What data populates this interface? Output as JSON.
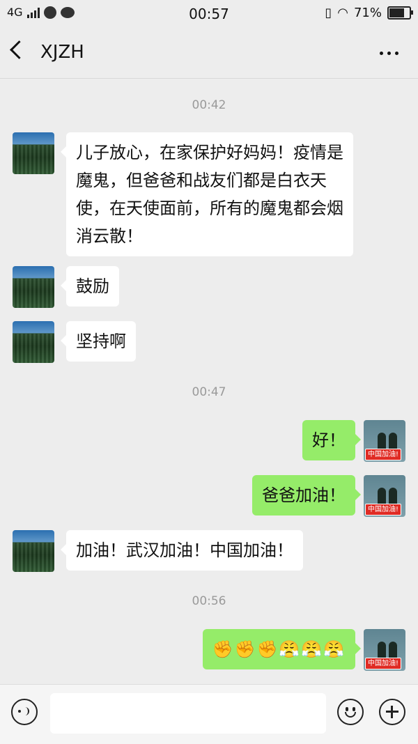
{
  "status_bar": {
    "network": "4G",
    "time": "00:57",
    "battery": "71%"
  },
  "header": {
    "title": "XJZH"
  },
  "timestamps": [
    "00:42",
    "00:47",
    "00:56"
  ],
  "messages": [
    {
      "from": "them",
      "text": "儿子放心，在家保护好妈妈！疫情是魔鬼，但爸爸和战友们都是白衣天使，在天使面前，所有的魔鬼都会烟消云散！"
    },
    {
      "from": "them",
      "text": "鼓励"
    },
    {
      "from": "them",
      "text": "坚持啊"
    },
    {
      "from": "me",
      "text": "好！"
    },
    {
      "from": "me",
      "text": "爸爸加油！"
    },
    {
      "from": "them",
      "text": "加油！武汉加油！中国加油！"
    },
    {
      "from": "me",
      "text": "✊✊✊😤😤😤"
    }
  ],
  "avatar_badge": "中国加油!",
  "colors": {
    "my_bubble": "#95ec69",
    "their_bubble": "#ffffff",
    "background": "#ededed"
  }
}
